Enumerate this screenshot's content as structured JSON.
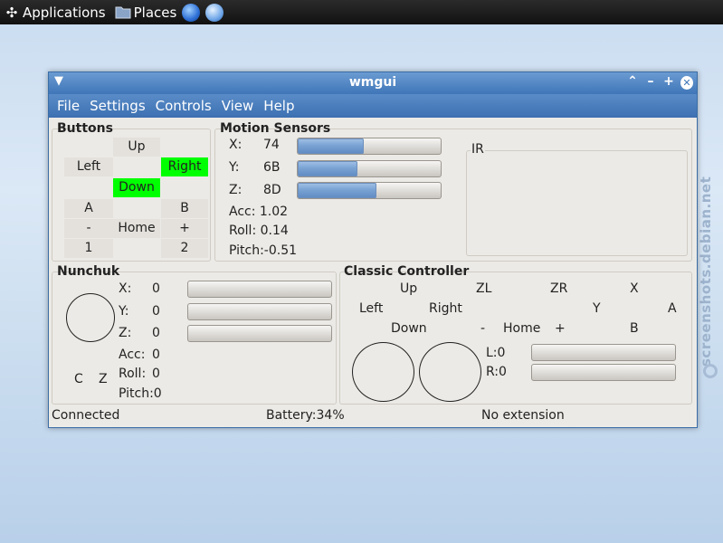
{
  "taskbar": {
    "applications": "Applications",
    "places": "Places"
  },
  "watermark": "screenshots.debian.net",
  "window": {
    "title": "wmgui",
    "menu": [
      "File",
      "Settings",
      "Controls",
      "View",
      "Help"
    ]
  },
  "buttons": {
    "title": "Buttons",
    "up": "Up",
    "left": "Left",
    "right": "Right",
    "down": "Down",
    "a": "A",
    "b": "B",
    "minus": "-",
    "home": "Home",
    "plus": "+",
    "one": "1",
    "two": "2",
    "pressed": [
      "Right",
      "Down"
    ],
    "pressed_color": "#00ff00"
  },
  "motion": {
    "title": "Motion Sensors",
    "x_label": "X:",
    "x_value": "74",
    "x_level": 0.46,
    "y_label": "Y:",
    "y_value": "6B",
    "y_level": 0.42,
    "z_label": "Z:",
    "z_value": "8D",
    "z_level": 0.55,
    "acc": "Acc:  1.02",
    "roll": "Roll:  0.14",
    "pitch": "Pitch:-0.51"
  },
  "ir": {
    "title": "IR"
  },
  "nunchuk": {
    "title": "Nunchuk",
    "x_label": "X:",
    "x_value": "0",
    "y_label": "Y:",
    "y_value": "0",
    "z_label": "Z:",
    "z_value": "0",
    "acc_label": "Acc:",
    "acc_value": "0",
    "roll_label": "Roll:",
    "roll_value": "0",
    "pitch": "Pitch:0",
    "c": "C",
    "z": "Z"
  },
  "classic": {
    "title": "Classic Controller",
    "up": "Up",
    "zl": "ZL",
    "zr": "ZR",
    "x": "X",
    "left": "Left",
    "right": "Right",
    "y": "Y",
    "a": "A",
    "down": "Down",
    "minus": "-",
    "home": "Home",
    "plus": "+",
    "b": "B",
    "l": "L:0",
    "r": "R:0"
  },
  "status": {
    "connection": "Connected",
    "battery": "Battery:34%",
    "extension": "No extension"
  },
  "colors": {
    "titlebar": "#3f76b8",
    "pressed": "#00ff00"
  }
}
